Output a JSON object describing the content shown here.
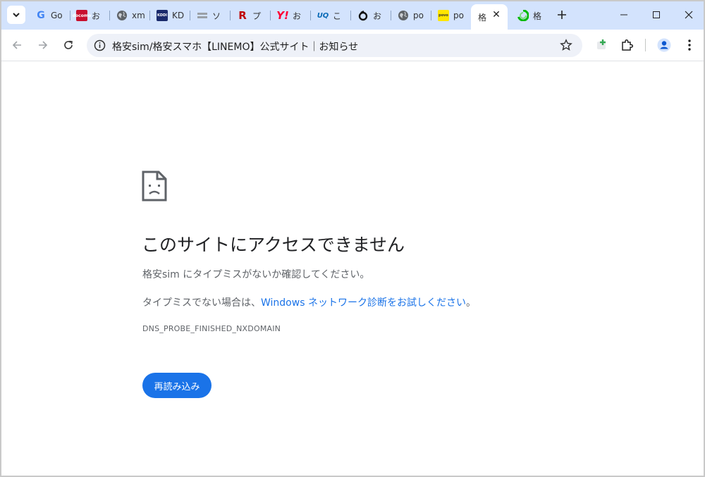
{
  "tabs": [
    {
      "name": "google",
      "title": "Go",
      "icon": "google-g-icon",
      "color": "#4285f4"
    },
    {
      "name": "docomo",
      "title": "お",
      "icon": "docomo-icon",
      "color": "#c8102e"
    },
    {
      "name": "globe1",
      "title": "xm",
      "icon": "globe-icon",
      "color": "#5f6368"
    },
    {
      "name": "kddi",
      "title": "KD",
      "icon": "kddi-icon",
      "color": "#1a2a6c"
    },
    {
      "name": "softbank",
      "title": "ソ",
      "icon": "softbank-icon",
      "color": "#9aa0a6"
    },
    {
      "name": "rakuten",
      "title": "プ",
      "icon": "rakuten-r-icon",
      "color": "#bf0000"
    },
    {
      "name": "ymobile",
      "title": "お",
      "icon": "ymobile-icon",
      "color": "#ff0033"
    },
    {
      "name": "uq",
      "title": "こ",
      "icon": "uq-icon",
      "color": "#0a6ab6"
    },
    {
      "name": "ahamo",
      "title": "お",
      "icon": "ahamo-icon",
      "color": "#111111"
    },
    {
      "name": "globe2",
      "title": "po",
      "icon": "globe-icon",
      "color": "#5f6368"
    },
    {
      "name": "povo",
      "title": "po",
      "icon": "povo-icon",
      "color": "#ffe600"
    },
    {
      "name": "active",
      "title": "格",
      "icon": "",
      "color": ""
    },
    {
      "name": "linemo",
      "title": "格",
      "icon": "linemo-icon",
      "color": "#00b900"
    }
  ],
  "toolbar": {
    "url": "格安sim/格安スマホ【LINEMO】公式サイト｜お知らせ"
  },
  "error": {
    "title": "このサイトにアクセスできません",
    "line1": "格安sim にタイプミスがないか確認してください。",
    "line2_prefix": "タイプミスでない場合は、",
    "line2_link": "Windows ネットワーク診断をお試しください",
    "line2_suffix": "。",
    "code": "DNS_PROBE_FINISHED_NXDOMAIN",
    "reload_label": "再読み込み"
  },
  "colors": {
    "tabstrip": "#d3e3fd",
    "omnibox": "#eef1f8",
    "accent": "#1a73e8"
  }
}
